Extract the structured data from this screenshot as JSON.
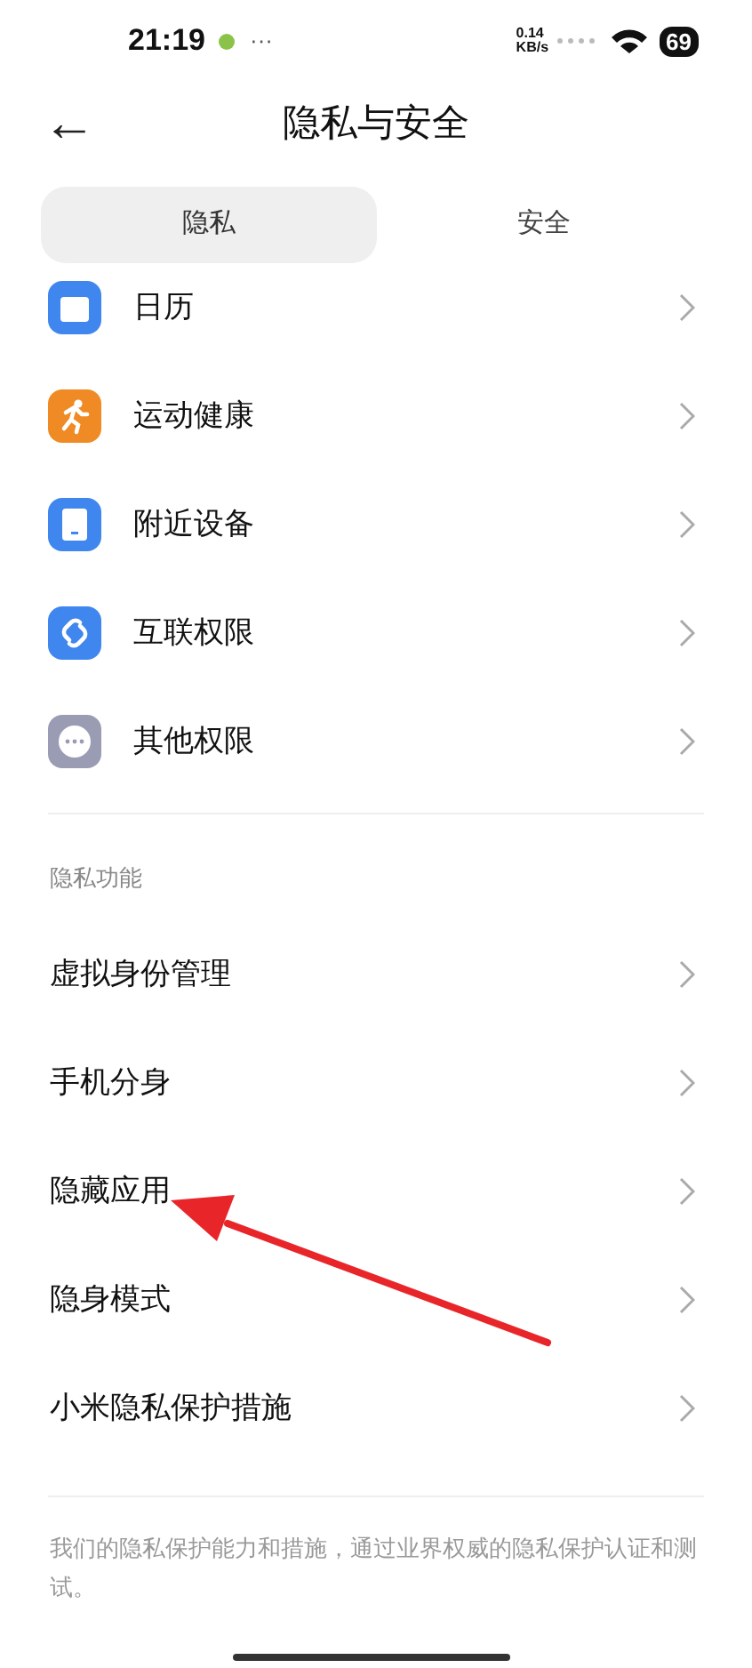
{
  "status_bar": {
    "time": "21:19",
    "more": "···",
    "speed_value": "0.14",
    "speed_unit": "KB/s",
    "battery": "69"
  },
  "header": {
    "back": "←",
    "title": "隐私与安全"
  },
  "tabs": [
    {
      "label": "隐私",
      "selected": true
    },
    {
      "label": "安全",
      "selected": false
    }
  ],
  "permissions": [
    {
      "label": "日历",
      "kind": "calendar",
      "color": "#3f86ee"
    },
    {
      "label": "运动健康",
      "kind": "runner",
      "color": "#f08a24"
    },
    {
      "label": "附近设备",
      "kind": "device",
      "color": "#3f86ee"
    },
    {
      "label": "互联权限",
      "kind": "link",
      "color": "#3f86ee"
    },
    {
      "label": "其他权限",
      "kind": "dots",
      "color": "#9a9cb4"
    }
  ],
  "privacy_section": {
    "title": "隐私功能",
    "items": [
      {
        "label": "虚拟身份管理"
      },
      {
        "label": "手机分身"
      },
      {
        "label": "隐藏应用"
      },
      {
        "label": "隐身模式"
      },
      {
        "label": "小米隐私保护措施"
      }
    ]
  },
  "footer": "我们的隐私保护能力和措施，通过业界权威的隐私保护认证和测试。",
  "annotation": {
    "kind": "arrow"
  }
}
